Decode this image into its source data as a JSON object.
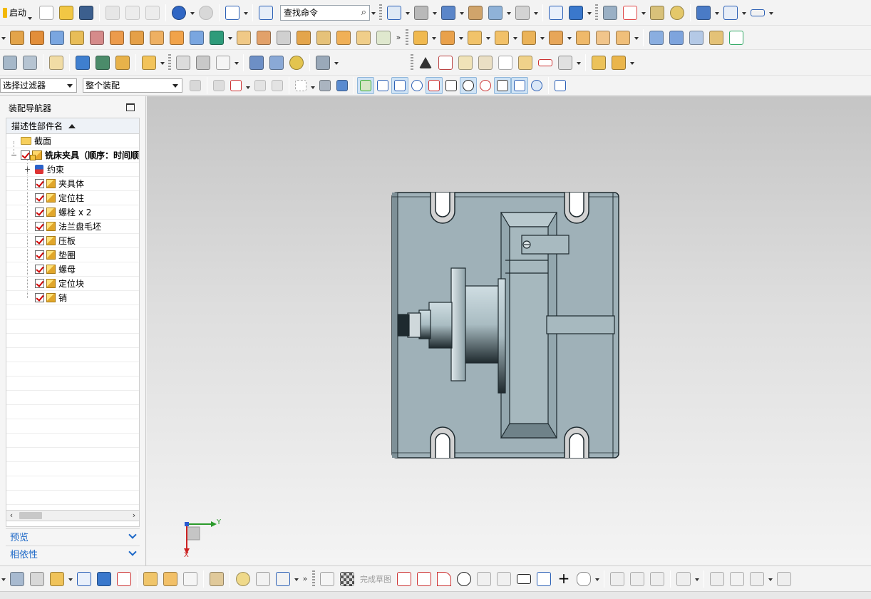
{
  "toolbar": {
    "start_label": "启动",
    "search_placeholder": "查找命令",
    "selection_filter": "选择过滤器",
    "assembly_scope": "整个装配",
    "more_glyph": "»"
  },
  "navigator": {
    "title": "装配导航器",
    "column_header": "描述性部件名",
    "rows": [
      {
        "label": "截面",
        "type": "folder"
      },
      {
        "label": "铣床夹具（顺序：时间顺",
        "type": "assembly",
        "checked": true
      },
      {
        "label": "约束",
        "type": "constraints"
      },
      {
        "label": "夹具体",
        "type": "part",
        "checked": true
      },
      {
        "label": "定位柱",
        "type": "part",
        "checked": true
      },
      {
        "label": "螺栓 x 2",
        "type": "part",
        "checked": true
      },
      {
        "label": "法兰盘毛坯",
        "type": "part",
        "checked": true
      },
      {
        "label": "压板",
        "type": "part",
        "checked": true
      },
      {
        "label": "垫圈",
        "type": "part",
        "checked": true
      },
      {
        "label": "螺母",
        "type": "part",
        "checked": true
      },
      {
        "label": "定位块",
        "type": "part",
        "checked": true
      },
      {
        "label": "销",
        "type": "part",
        "checked": true
      }
    ],
    "preview_label": "预览",
    "dependency_label": "相依性"
  },
  "viewport": {
    "axis_y": "Y",
    "axis_x": "X"
  },
  "bottombar": {
    "finish_sketch_label": "完成草图"
  },
  "colors": {
    "part_body": "#9fb1b8",
    "part_shadow": "#7e9097",
    "edge": "#1e2a2f",
    "accent_blue": "#1b67c7"
  }
}
